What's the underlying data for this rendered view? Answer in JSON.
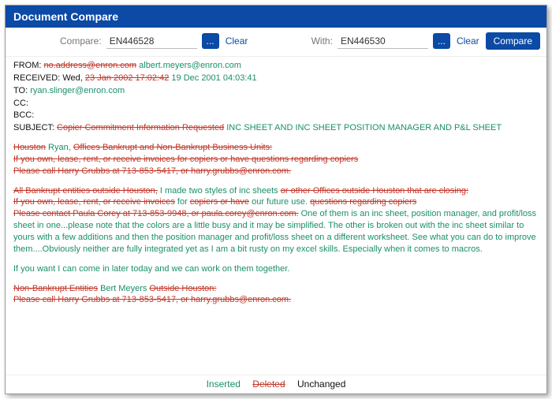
{
  "window": {
    "title": "Document Compare"
  },
  "toolbar": {
    "compare_label": "Compare:",
    "compare_value": "EN446528",
    "with_label": "With:",
    "with_value": "EN446530",
    "dots": "...",
    "clear": "Clear",
    "compare_btn": "Compare"
  },
  "headers": {
    "from_key": "FROM:",
    "from_del": "no.address@enron.com",
    "from_ins": "albert.meyers@enron.com",
    "received_key": "RECEIVED:",
    "received_unc": "Wed,",
    "received_del": "23 Jan 2002 17:02:42",
    "received_ins": "19 Dec 2001 04:03:41",
    "to_key": "TO:",
    "to_ins": "ryan.slinger@enron.com",
    "cc_key": "CC:",
    "bcc_key": "BCC:",
    "subject_key": "SUBJECT:",
    "subject_del": "Copier Commitment Information Requested",
    "subject_ins": "INC SHEET AND INC SHEET POSITION MANAGER AND P&L SHEET"
  },
  "body": {
    "p1_a_del": "Houston",
    "p1_a_ins": "Ryan,",
    "p1_a_del2": "Offices Bankrupt and Non-Bankrupt Business Units:",
    "p1_b_del": "If you own, lease, rent, or receive invoices for copiers or have questions regarding copiers",
    "p1_c_del": "Please call Harry Grubbs at 713-853-5417, or harry.grubbs@enron.com.",
    "p2_a_del": "All Bankrupt entities outside Houston,",
    "p2_a_ins": "I made two styles of inc sheets",
    "p2_a_del2": "or other Offices outside Houston that are closing:",
    "p2_b_del1": "If you own, lease, rent, or receive invoices",
    "p2_b_ins1": "for",
    "p2_b_del2": "copiers or have",
    "p2_b_ins2": "our future use.",
    "p2_b_del3": "questions regarding copiers",
    "p2_c_del": "Please contact Paula Corey at 713-853-9948, or paula.corey@enron.com.",
    "p2_c_ins": "One of them is an inc sheet, position manager, and profit/loss sheet in one...please note that the colors are a little busy and it may be simplified. The other is broken out with the inc sheet similar to yours with a few additions and then the position manager and profit/loss sheet on a different worksheet. See what you can do to improve them....Obviously neither are fully integrated yet as I am a bit rusty on my excel skills. Especially when it comes to macros.",
    "p3_ins": "If you want I can come in later today and we can work on them together.",
    "p4_a_del1": "Non-Bankrupt Entities",
    "p4_a_ins": "Bert Meyers",
    "p4_a_del2": "Outside Houston:",
    "p4_b_del": "Please call Harry Grubbs at 713-853-5417, or harry.grubbs@enron.com."
  },
  "legend": {
    "inserted": "Inserted",
    "deleted": "Deleted",
    "unchanged": "Unchanged"
  }
}
